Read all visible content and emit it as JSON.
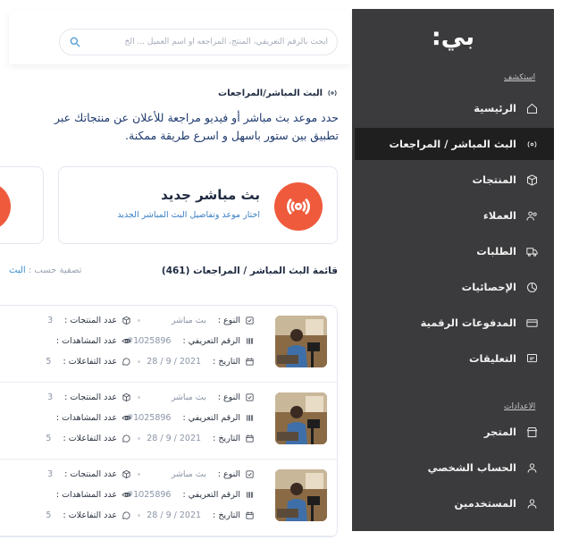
{
  "app": {
    "logo_text": "بي:",
    "search_placeholder": "ابحث بالرقم التعريفي، المنتج، المراجعه أو اسم العميل ... الخ"
  },
  "sidebar": {
    "section_explore": "استكشف",
    "section_settings": "الاعدادات",
    "items": [
      {
        "label": "الرئيسية",
        "icon": "home-icon"
      },
      {
        "label": "البث المباشر / المراجعات",
        "icon": "broadcast-icon",
        "active": true
      },
      {
        "label": "المنتجات",
        "icon": "box-icon"
      },
      {
        "label": "العملاء",
        "icon": "users-icon"
      },
      {
        "label": "الطلبات",
        "icon": "truck-icon"
      },
      {
        "label": "الإحصائيات",
        "icon": "pie-chart-icon"
      },
      {
        "label": "المدفوعات الرقمية",
        "icon": "card-icon"
      },
      {
        "label": "التعليقات",
        "icon": "comment-icon"
      }
    ],
    "settings_items": [
      {
        "label": "المتجر",
        "icon": "store-icon"
      },
      {
        "label": "الحساب الشخصي",
        "icon": "user-icon"
      },
      {
        "label": "المستخدمين",
        "icon": "users-settings-icon"
      }
    ]
  },
  "main": {
    "page_title": "البث المباشر/المراجعات",
    "intro": "حدد موعد بث مباشر أو فيديو مراجعة للأعلان عن منتجاتك عبر تطبيق بين ستور باسهل و اسرع طريقة ممكنة.",
    "promo": {
      "title": "بث مباشر جديد",
      "subtitle": "اختار موعد وتفاصيل البث المباشر الجديد"
    },
    "list_title": "قائمة البث المباشر / المراجعات (461)",
    "filter_label": "تصفية حسب :",
    "filter_value": "البث"
  },
  "rows": [
    {
      "type_label": "النوع :",
      "type_value": "بث مباشر",
      "id_label": "الرقم التعريفي :",
      "id_value": "#1025896",
      "date_label": "التاريخ :",
      "date_value": "2021 / 9 / 28",
      "products_label": "عدد المنتجات :",
      "products_value": "3",
      "views_label": "عدد المشاهدات :",
      "views_value": "",
      "interactions_label": "عدد التفاعلات :",
      "interactions_value": "5"
    },
    {
      "type_label": "النوع :",
      "type_value": "بث مباشر",
      "id_label": "الرقم التعريفي :",
      "id_value": "#1025896",
      "date_label": "التاريخ :",
      "date_value": "2021 / 9 / 28",
      "products_label": "عدد المنتجات :",
      "products_value": "3",
      "views_label": "عدد المشاهدات :",
      "views_value": "",
      "interactions_label": "عدد التفاعلات :",
      "interactions_value": "5"
    },
    {
      "type_label": "النوع :",
      "type_value": "بث مباشر",
      "id_label": "الرقم التعريفي :",
      "id_value": "#1025896",
      "date_label": "التاريخ :",
      "date_value": "2021 / 9 / 28",
      "products_label": "عدد المنتجات :",
      "products_value": "3",
      "views_label": "عدد المشاهدات :",
      "views_value": "",
      "interactions_label": "عدد التفاعلات :",
      "interactions_value": "5"
    }
  ],
  "colors": {
    "sidebar": "#3b3b3d",
    "active": "#1f1f20",
    "accent": "#ef5a3c",
    "link": "#3a7fc4"
  }
}
